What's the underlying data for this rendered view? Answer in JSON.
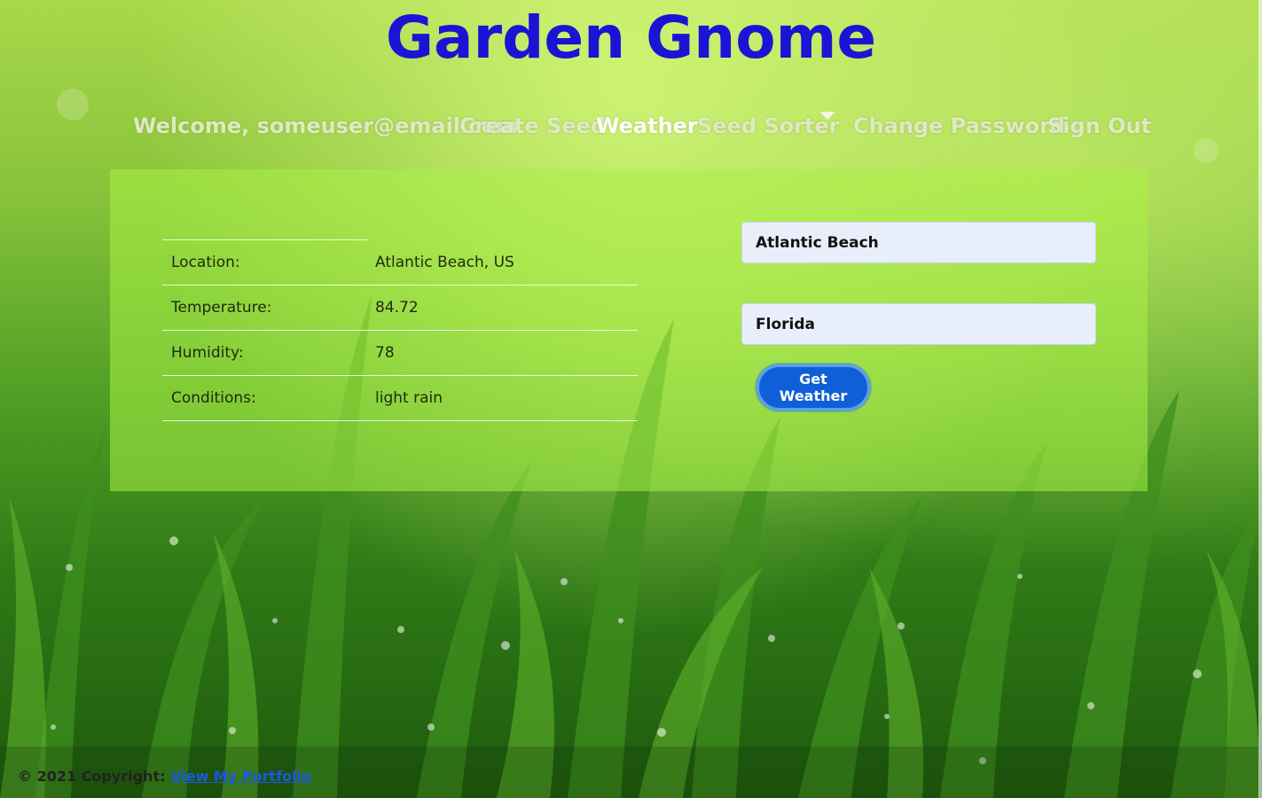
{
  "site": {
    "title": "Garden Gnome"
  },
  "nav": {
    "welcome": "Welcome, someuser@email.com",
    "create_seed": "Create Seed",
    "weather": "Weather",
    "seed_sorter": "Seed Sorter",
    "change_password": "Change Password",
    "sign_out": "Sign Out"
  },
  "weather": {
    "rows": [
      {
        "label": "Location:",
        "value": "Atlantic Beach, US"
      },
      {
        "label": "Temperature:",
        "value": "84.72"
      },
      {
        "label": "Humidity:",
        "value": "78"
      },
      {
        "label": "Conditions:",
        "value": "light rain"
      }
    ]
  },
  "form": {
    "city_value": "Atlantic Beach",
    "state_value": "Florida",
    "submit_label": "Get Weather"
  },
  "footer": {
    "copyright": "© 2021 Copyright:",
    "link_label": "View My Portfolio"
  },
  "colors": {
    "title": "#1a14d4",
    "button": "#0f5fd8",
    "link": "#1b57e6"
  }
}
